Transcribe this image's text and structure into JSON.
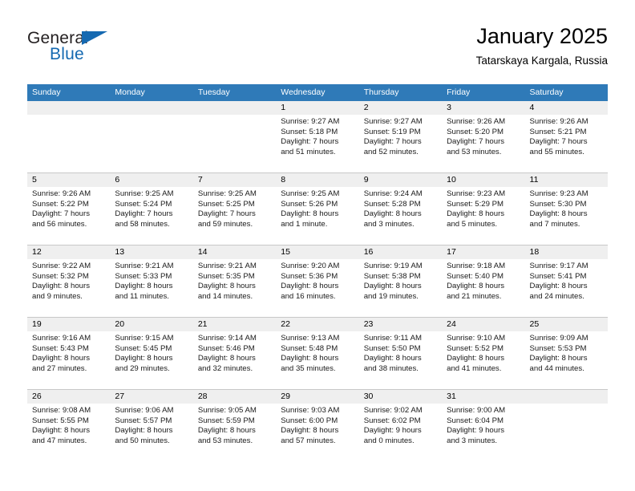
{
  "brand": {
    "name_part1": "General",
    "name_part2": "Blue",
    "accent_color": "#1569b1"
  },
  "header": {
    "title": "January 2025",
    "location": "Tatarskaya Kargala, Russia"
  },
  "theme": {
    "header_bar_color": "#2f7ab8",
    "daynum_band_color": "#efefef",
    "grid_line_color": "#c8c8c8"
  },
  "weekdays": [
    "Sunday",
    "Monday",
    "Tuesday",
    "Wednesday",
    "Thursday",
    "Friday",
    "Saturday"
  ],
  "weeks": [
    [
      {
        "day": "",
        "lines": []
      },
      {
        "day": "",
        "lines": []
      },
      {
        "day": "",
        "lines": []
      },
      {
        "day": "1",
        "lines": [
          "Sunrise: 9:27 AM",
          "Sunset: 5:18 PM",
          "Daylight: 7 hours",
          "and 51 minutes."
        ]
      },
      {
        "day": "2",
        "lines": [
          "Sunrise: 9:27 AM",
          "Sunset: 5:19 PM",
          "Daylight: 7 hours",
          "and 52 minutes."
        ]
      },
      {
        "day": "3",
        "lines": [
          "Sunrise: 9:26 AM",
          "Sunset: 5:20 PM",
          "Daylight: 7 hours",
          "and 53 minutes."
        ]
      },
      {
        "day": "4",
        "lines": [
          "Sunrise: 9:26 AM",
          "Sunset: 5:21 PM",
          "Daylight: 7 hours",
          "and 55 minutes."
        ]
      }
    ],
    [
      {
        "day": "5",
        "lines": [
          "Sunrise: 9:26 AM",
          "Sunset: 5:22 PM",
          "Daylight: 7 hours",
          "and 56 minutes."
        ]
      },
      {
        "day": "6",
        "lines": [
          "Sunrise: 9:25 AM",
          "Sunset: 5:24 PM",
          "Daylight: 7 hours",
          "and 58 minutes."
        ]
      },
      {
        "day": "7",
        "lines": [
          "Sunrise: 9:25 AM",
          "Sunset: 5:25 PM",
          "Daylight: 7 hours",
          "and 59 minutes."
        ]
      },
      {
        "day": "8",
        "lines": [
          "Sunrise: 9:25 AM",
          "Sunset: 5:26 PM",
          "Daylight: 8 hours",
          "and 1 minute."
        ]
      },
      {
        "day": "9",
        "lines": [
          "Sunrise: 9:24 AM",
          "Sunset: 5:28 PM",
          "Daylight: 8 hours",
          "and 3 minutes."
        ]
      },
      {
        "day": "10",
        "lines": [
          "Sunrise: 9:23 AM",
          "Sunset: 5:29 PM",
          "Daylight: 8 hours",
          "and 5 minutes."
        ]
      },
      {
        "day": "11",
        "lines": [
          "Sunrise: 9:23 AM",
          "Sunset: 5:30 PM",
          "Daylight: 8 hours",
          "and 7 minutes."
        ]
      }
    ],
    [
      {
        "day": "12",
        "lines": [
          "Sunrise: 9:22 AM",
          "Sunset: 5:32 PM",
          "Daylight: 8 hours",
          "and 9 minutes."
        ]
      },
      {
        "day": "13",
        "lines": [
          "Sunrise: 9:21 AM",
          "Sunset: 5:33 PM",
          "Daylight: 8 hours",
          "and 11 minutes."
        ]
      },
      {
        "day": "14",
        "lines": [
          "Sunrise: 9:21 AM",
          "Sunset: 5:35 PM",
          "Daylight: 8 hours",
          "and 14 minutes."
        ]
      },
      {
        "day": "15",
        "lines": [
          "Sunrise: 9:20 AM",
          "Sunset: 5:36 PM",
          "Daylight: 8 hours",
          "and 16 minutes."
        ]
      },
      {
        "day": "16",
        "lines": [
          "Sunrise: 9:19 AM",
          "Sunset: 5:38 PM",
          "Daylight: 8 hours",
          "and 19 minutes."
        ]
      },
      {
        "day": "17",
        "lines": [
          "Sunrise: 9:18 AM",
          "Sunset: 5:40 PM",
          "Daylight: 8 hours",
          "and 21 minutes."
        ]
      },
      {
        "day": "18",
        "lines": [
          "Sunrise: 9:17 AM",
          "Sunset: 5:41 PM",
          "Daylight: 8 hours",
          "and 24 minutes."
        ]
      }
    ],
    [
      {
        "day": "19",
        "lines": [
          "Sunrise: 9:16 AM",
          "Sunset: 5:43 PM",
          "Daylight: 8 hours",
          "and 27 minutes."
        ]
      },
      {
        "day": "20",
        "lines": [
          "Sunrise: 9:15 AM",
          "Sunset: 5:45 PM",
          "Daylight: 8 hours",
          "and 29 minutes."
        ]
      },
      {
        "day": "21",
        "lines": [
          "Sunrise: 9:14 AM",
          "Sunset: 5:46 PM",
          "Daylight: 8 hours",
          "and 32 minutes."
        ]
      },
      {
        "day": "22",
        "lines": [
          "Sunrise: 9:13 AM",
          "Sunset: 5:48 PM",
          "Daylight: 8 hours",
          "and 35 minutes."
        ]
      },
      {
        "day": "23",
        "lines": [
          "Sunrise: 9:11 AM",
          "Sunset: 5:50 PM",
          "Daylight: 8 hours",
          "and 38 minutes."
        ]
      },
      {
        "day": "24",
        "lines": [
          "Sunrise: 9:10 AM",
          "Sunset: 5:52 PM",
          "Daylight: 8 hours",
          "and 41 minutes."
        ]
      },
      {
        "day": "25",
        "lines": [
          "Sunrise: 9:09 AM",
          "Sunset: 5:53 PM",
          "Daylight: 8 hours",
          "and 44 minutes."
        ]
      }
    ],
    [
      {
        "day": "26",
        "lines": [
          "Sunrise: 9:08 AM",
          "Sunset: 5:55 PM",
          "Daylight: 8 hours",
          "and 47 minutes."
        ]
      },
      {
        "day": "27",
        "lines": [
          "Sunrise: 9:06 AM",
          "Sunset: 5:57 PM",
          "Daylight: 8 hours",
          "and 50 minutes."
        ]
      },
      {
        "day": "28",
        "lines": [
          "Sunrise: 9:05 AM",
          "Sunset: 5:59 PM",
          "Daylight: 8 hours",
          "and 53 minutes."
        ]
      },
      {
        "day": "29",
        "lines": [
          "Sunrise: 9:03 AM",
          "Sunset: 6:00 PM",
          "Daylight: 8 hours",
          "and 57 minutes."
        ]
      },
      {
        "day": "30",
        "lines": [
          "Sunrise: 9:02 AM",
          "Sunset: 6:02 PM",
          "Daylight: 9 hours",
          "and 0 minutes."
        ]
      },
      {
        "day": "31",
        "lines": [
          "Sunrise: 9:00 AM",
          "Sunset: 6:04 PM",
          "Daylight: 9 hours",
          "and 3 minutes."
        ]
      },
      {
        "day": "",
        "lines": []
      }
    ]
  ]
}
